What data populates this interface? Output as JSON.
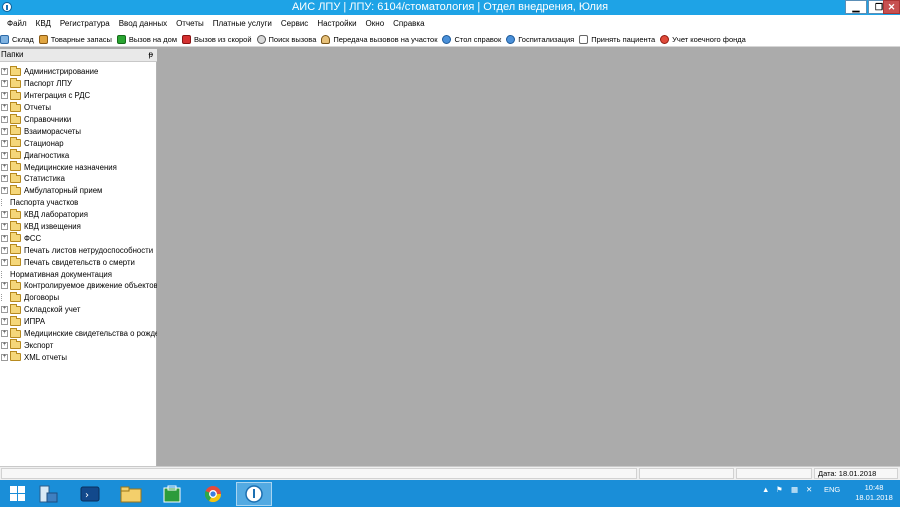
{
  "window": {
    "title": "АИС ЛПУ | ЛПУ: 6104/стоматология | Отдел внедрения, Юлия",
    "min_glyph": "▁",
    "max_glyph": "❐",
    "close_glyph": "✕"
  },
  "menu": [
    "Файл",
    "КВД",
    "Регистратура",
    "Ввод данных",
    "Отчеты",
    "Платные услуги",
    "Сервис",
    "Настройки",
    "Окно",
    "Справка"
  ],
  "toolbar": [
    {
      "label": "Склад",
      "icon": "cart-icon"
    },
    {
      "label": "Товарные запасы",
      "icon": "boxes-icon"
    },
    {
      "label": "Вызов на дом",
      "icon": "house-call-icon"
    },
    {
      "label": "Вызов из скорой",
      "icon": "ambulance-icon"
    },
    {
      "label": "Поиск вызова",
      "icon": "search-call-icon"
    },
    {
      "label": "Передача вызовов на участок",
      "icon": "transfer-icon"
    },
    {
      "label": "Стол справок",
      "icon": "globe-icon"
    },
    {
      "label": "Госпитализация",
      "icon": "hospital-icon"
    },
    {
      "label": "Принять пациента",
      "icon": "accept-patient-icon"
    },
    {
      "label": "Учет коечного фонда",
      "icon": "bed-fund-icon"
    }
  ],
  "panel": {
    "title": "Папки",
    "pin_glyph": "ᵽ",
    "items": [
      "Администрирование",
      "Паспорт ЛПУ",
      "Интеграция с РДС",
      "Отчеты",
      "Справочники",
      "Взаиморасчеты",
      "Стационар",
      "Диагностика",
      "Медицинские назначения",
      "Статистика",
      "Амбулаторный прием",
      "Паспорта участков",
      "КВД лаборатория",
      "КВД извещения",
      "ФСС",
      "Печать листов нетрудоспособности",
      "Печать свидетельств о смерти",
      "Нормативная документация",
      "Контролируемое движение объектов",
      "Договоры",
      "Складской учет",
      "ИПРА",
      "Медицинские свидетельства о рождении",
      "Экспорт",
      "XML отчеты"
    ],
    "scroll_left": "<",
    "scroll_right": ">"
  },
  "status": {
    "date": "Дата: 18.01.2018"
  },
  "taskbar": {
    "lang": "ENG",
    "time": "10:48",
    "date": "18.01.2018"
  },
  "colors": {
    "titlebar": "#1ea3e6",
    "taskbar": "#1a8ed8",
    "workspace": "#ababab"
  }
}
